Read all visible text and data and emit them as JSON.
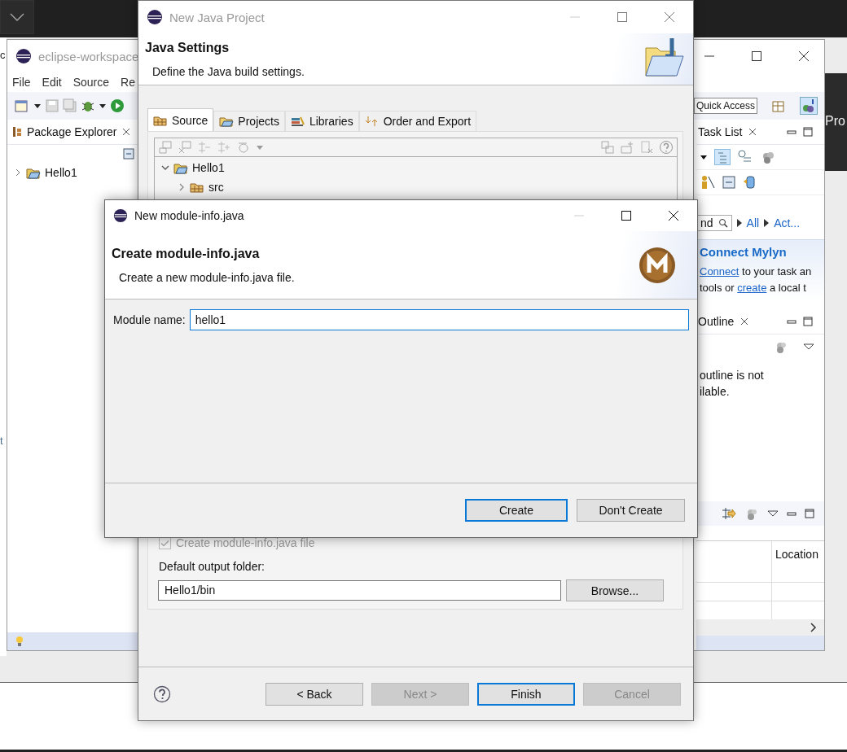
{
  "background": {
    "left_edge_texts": [
      "c",
      "t"
    ],
    "right_edge_text": "Pro"
  },
  "workspace_window": {
    "title": "eclipse-workspace",
    "menu": [
      "File",
      "Edit",
      "Source",
      "Re"
    ],
    "quick_access": "Quick Access",
    "package_explorer": {
      "title": "Package Explorer",
      "tree": [
        {
          "label": "Hello1",
          "expanded": false
        }
      ]
    },
    "task_list": {
      "title": "Task List",
      "find_field": "nd",
      "filters": [
        "All",
        "Act..."
      ]
    },
    "mylyn": {
      "title": "Connect Mylyn",
      "lines": [
        [
          {
            "kind": "link",
            "text": "Connect"
          },
          {
            "kind": "text",
            "text": " to your task an"
          }
        ],
        [
          {
            "kind": "text",
            "text": "tools or "
          },
          {
            "kind": "link",
            "text": "create"
          },
          {
            "kind": "text",
            "text": " a local t"
          }
        ]
      ]
    },
    "outline": {
      "title": "Outline",
      "message_lines": [
        "outline is not",
        "ilable."
      ]
    },
    "bottom_view": {
      "columns": [
        "Location"
      ]
    }
  },
  "java_project_dialog": {
    "title": "New Java Project",
    "heading": "Java Settings",
    "description": "Define the Java build settings.",
    "tabs": [
      {
        "label": "Source",
        "selected": true
      },
      {
        "label": "Projects",
        "selected": false
      },
      {
        "label": "Libraries",
        "selected": false
      },
      {
        "label": "Order and Export",
        "selected": false
      }
    ],
    "tree": [
      {
        "label": "Hello1",
        "expanded": true,
        "children": [
          {
            "label": "src",
            "expanded": false
          }
        ]
      }
    ],
    "module_checkbox": {
      "label": "Create module-info.java file",
      "checked": true,
      "disabled": true
    },
    "output_folder": {
      "label": "Default output folder:",
      "value": "Hello1/bin",
      "button": "Browse..."
    },
    "buttons": [
      {
        "label": "< Back",
        "disabled": false,
        "default": false
      },
      {
        "label": "Next >",
        "disabled": true,
        "default": false
      },
      {
        "label": "Finish",
        "disabled": false,
        "default": true
      },
      {
        "label": "Cancel",
        "disabled": true,
        "default": false
      }
    ]
  },
  "module_dialog": {
    "title": "New module-info.java",
    "heading": "Create module-info.java",
    "description": "Create a new module-info.java file.",
    "field_label": "Module name:",
    "field_value": "hello1",
    "buttons": [
      {
        "label": "Create",
        "default": true
      },
      {
        "label": "Don't Create",
        "default": false
      }
    ]
  }
}
